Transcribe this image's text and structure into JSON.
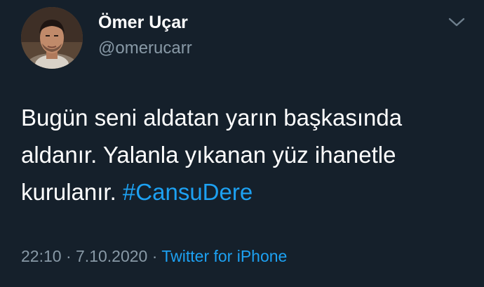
{
  "user": {
    "display_name": "Ömer Uçar",
    "handle": "@omerucarr"
  },
  "tweet": {
    "lines": [
      "Bugün seni aldatan yarın başkasında",
      "aldanır. Yalanla yıkanan yüz ihanetle",
      "kurulanır. "
    ],
    "hashtag": "#CansuDere"
  },
  "meta": {
    "time": "22:10",
    "separator": " · ",
    "date": "7.10.2020",
    "source": "Twitter for iPhone"
  },
  "icons": {
    "menu": "chevron-down-icon"
  },
  "colors": {
    "background": "#15202b",
    "accent": "#1da1f2",
    "secondary_text": "#8899a6"
  }
}
